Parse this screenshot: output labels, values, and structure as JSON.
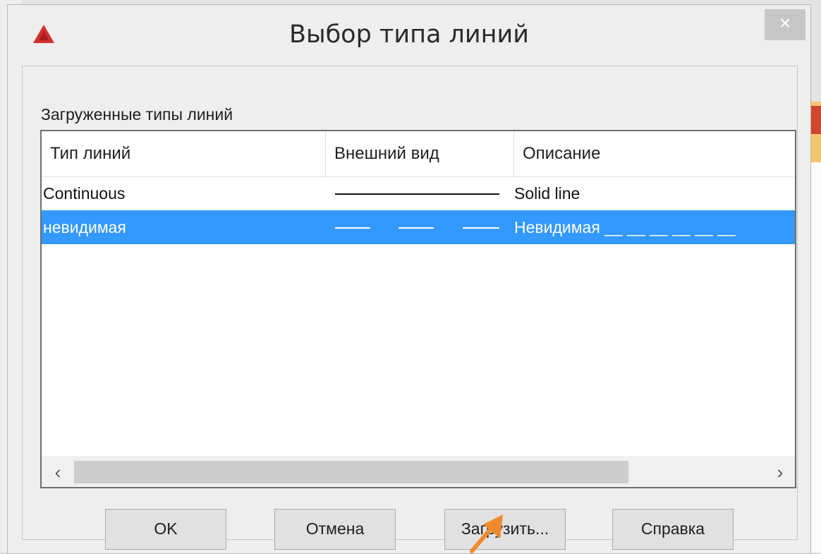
{
  "dialog": {
    "title": "Выбор типа линий",
    "close_label": "×"
  },
  "list": {
    "group_label": "Загруженные типы линий",
    "columns": [
      "Тип линий",
      "Внешний вид",
      "Описание"
    ],
    "rows": [
      {
        "name": "Continuous",
        "description": "Solid line",
        "appearance": "solid",
        "selected": false
      },
      {
        "name": "невидимая",
        "description": "Невидимая __ __ __ __ __ __",
        "appearance": "dashed",
        "selected": true
      }
    ],
    "scroll_left": "‹",
    "scroll_right": "›"
  },
  "buttons": {
    "ok": "OK",
    "cancel": "Отмена",
    "load": "Загрузить...",
    "help": "Справка"
  },
  "colors": {
    "selection": "#3399ff",
    "annotation": "#f08a2c",
    "logo": "#d32f2f"
  },
  "icons": {
    "app_logo": "autocad-logo-icon",
    "annotation": "orange-arrow-icon"
  }
}
